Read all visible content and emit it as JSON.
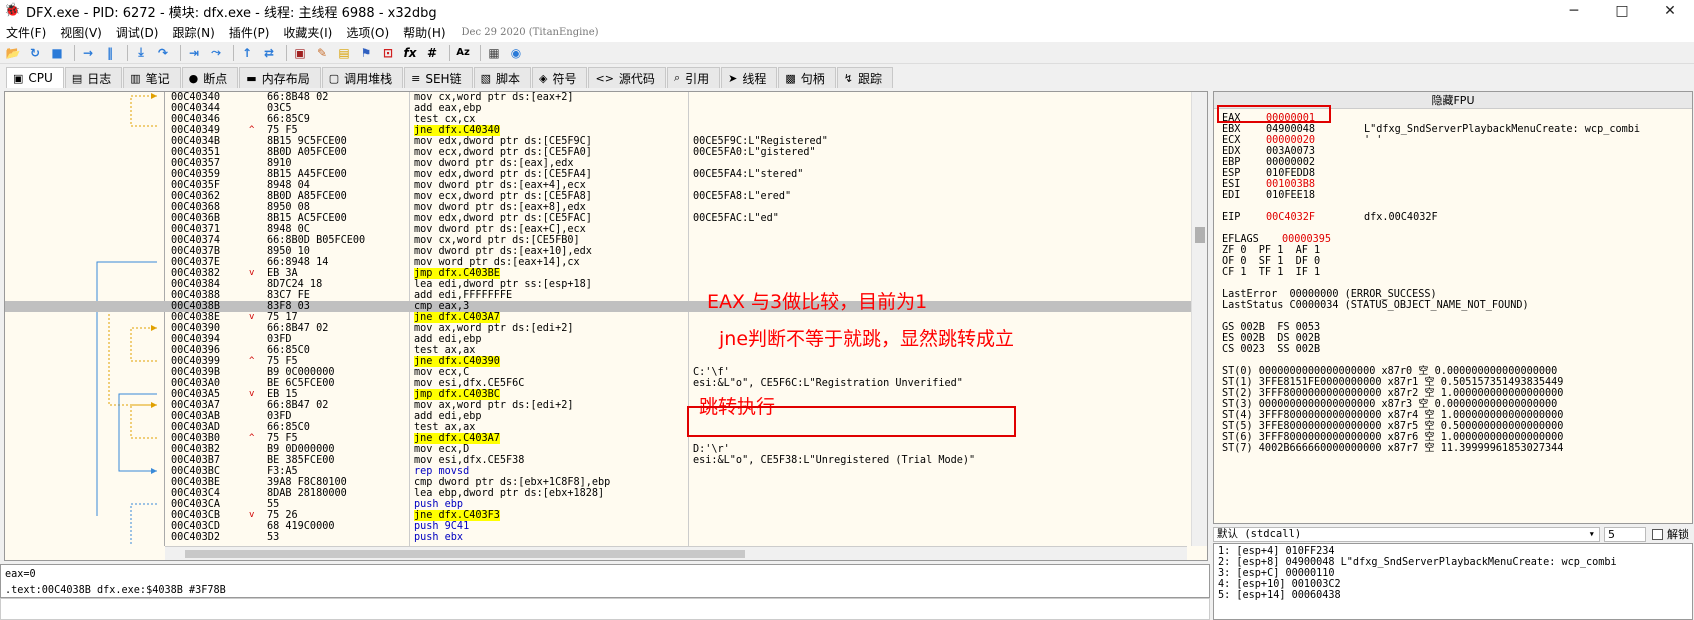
{
  "window": {
    "title": "DFX.exe - PID: 6272 - 模块: dfx.exe - 线程: 主线程 6988 - x32dbg",
    "minimize": "─",
    "maximize": "□",
    "close": "✕"
  },
  "menu": {
    "items": [
      "文件(F)",
      "视图(V)",
      "调试(D)",
      "跟踪(N)",
      "插件(P)",
      "收藏夹(I)",
      "选项(O)",
      "帮助(H)"
    ],
    "build_date": "Dec 29 2020 (TitanEngine)"
  },
  "toolbar": {
    "icons": [
      "open-icon",
      "restart-icon",
      "stop-icon",
      "run-icon",
      "pause-icon",
      "step-into-icon",
      "step-over-icon",
      "trace-into-icon",
      "trace-over-icon",
      "execute-till-return-icon",
      "run-to-user-code-icon",
      "patch-icon",
      "comment-icon",
      "label-icon",
      "bookmark-icon",
      "function-icon",
      "expression-icon",
      "hash-icon",
      "string-format-icon",
      "calculator-icon",
      "system-info-icon"
    ],
    "glyphs": [
      "📂",
      "↻",
      "■",
      "→",
      "‖",
      "⤓",
      "↷",
      "⇥",
      "⤳",
      "↑",
      "⇄",
      "▣",
      "✎",
      "▤",
      "⚑",
      "⊡",
      "fx",
      "#",
      "Az",
      "▦",
      "◉"
    ]
  },
  "tabs": [
    {
      "icon": "cpu-icon",
      "glyph": "▣",
      "label": "CPU",
      "active": true
    },
    {
      "icon": "log-icon",
      "glyph": "▤",
      "label": "日志"
    },
    {
      "icon": "notes-icon",
      "glyph": "▥",
      "label": "笔记"
    },
    {
      "icon": "breakpoint-icon",
      "glyph": "●",
      "label": "断点"
    },
    {
      "icon": "memory-map-icon",
      "glyph": "▬",
      "label": "内存布局"
    },
    {
      "icon": "call-stack-icon",
      "glyph": "▢",
      "label": "调用堆栈"
    },
    {
      "icon": "seh-icon",
      "glyph": "≡",
      "label": "SEH链"
    },
    {
      "icon": "script-icon",
      "glyph": "▧",
      "label": "脚本"
    },
    {
      "icon": "symbols-icon",
      "glyph": "◈",
      "label": "符号"
    },
    {
      "icon": "source-icon",
      "glyph": "<>",
      "label": "源代码"
    },
    {
      "icon": "references-icon",
      "glyph": "⌕",
      "label": "引用"
    },
    {
      "icon": "threads-icon",
      "glyph": "➤",
      "label": "线程"
    },
    {
      "icon": "handles-icon",
      "glyph": "▩",
      "label": "句柄"
    },
    {
      "icon": "trace-icon",
      "glyph": "↯",
      "label": "跟踪"
    }
  ],
  "disasm": {
    "rows": [
      {
        "addr": "00C40340",
        "arrow": "",
        "bytes": "66:8B48 02",
        "instr": "mov cx,word ptr ds:[eax+2]",
        "cmt": ""
      },
      {
        "addr": "00C40344",
        "arrow": "",
        "bytes": "03C5",
        "instr": "add eax,ebp",
        "cmt": ""
      },
      {
        "addr": "00C40346",
        "arrow": "",
        "bytes": "66:85C9",
        "instr": "test cx,cx",
        "cmt": ""
      },
      {
        "addr": "00C40349",
        "arrow": "^",
        "bytes": "75 F5",
        "instr": "jne dfx.C40340",
        "cmt": ""
      },
      {
        "addr": "00C4034B",
        "arrow": "",
        "bytes": "8B15 9C5FCE00",
        "instr": "mov edx,dword ptr ds:[CE5F9C]",
        "cmt": "00CE5F9C:L\"Registered\""
      },
      {
        "addr": "00C40351",
        "arrow": "",
        "bytes": "8B0D A05FCE00",
        "instr": "mov ecx,dword ptr ds:[CE5FA0]",
        "cmt": "00CE5FA0:L\"gistered\""
      },
      {
        "addr": "00C40357",
        "arrow": "",
        "bytes": "8910",
        "instr": "mov dword ptr ds:[eax],edx",
        "cmt": ""
      },
      {
        "addr": "00C40359",
        "arrow": "",
        "bytes": "8B15 A45FCE00",
        "instr": "mov edx,dword ptr ds:[CE5FA4]",
        "cmt": "00CE5FA4:L\"stered\""
      },
      {
        "addr": "00C4035F",
        "arrow": "",
        "bytes": "8948 04",
        "instr": "mov dword ptr ds:[eax+4],ecx",
        "cmt": ""
      },
      {
        "addr": "00C40362",
        "arrow": "",
        "bytes": "8B0D A85FCE00",
        "instr": "mov ecx,dword ptr ds:[CE5FA8]",
        "cmt": "00CE5FA8:L\"ered\""
      },
      {
        "addr": "00C40368",
        "arrow": "",
        "bytes": "8950 08",
        "instr": "mov dword ptr ds:[eax+8],edx",
        "cmt": ""
      },
      {
        "addr": "00C4036B",
        "arrow": "",
        "bytes": "8B15 AC5FCE00",
        "instr": "mov edx,dword ptr ds:[CE5FAC]",
        "cmt": "00CE5FAC:L\"ed\""
      },
      {
        "addr": "00C40371",
        "arrow": "",
        "bytes": "8948 0C",
        "instr": "mov dword ptr ds:[eax+C],ecx",
        "cmt": ""
      },
      {
        "addr": "00C40374",
        "arrow": "",
        "bytes": "66:8B0D B05FCE00",
        "instr": "mov cx,word ptr ds:[CE5FB0]",
        "cmt": ""
      },
      {
        "addr": "00C4037B",
        "arrow": "",
        "bytes": "8950 10",
        "instr": "mov dword ptr ds:[eax+10],edx",
        "cmt": ""
      },
      {
        "addr": "00C4037E",
        "arrow": "",
        "bytes": "66:8948 14",
        "instr": "mov word ptr ds:[eax+14],cx",
        "cmt": ""
      },
      {
        "addr": "00C40382",
        "arrow": "v",
        "bytes": "EB 3A",
        "instr": "jmp dfx.C403BE",
        "cmt": ""
      },
      {
        "addr": "00C40384",
        "arrow": "",
        "bytes": "8D7C24 18",
        "instr": "lea edi,dword ptr ss:[esp+18]",
        "cmt": ""
      },
      {
        "addr": "00C40388",
        "arrow": "",
        "bytes": "83C7 FE",
        "instr": "add edi,FFFFFFFE",
        "cmt": ""
      },
      {
        "addr": "00C4038B",
        "arrow": "",
        "bytes": "83F8 03",
        "instr": "cmp eax,3",
        "cmt": "",
        "sel": true
      },
      {
        "addr": "00C4038E",
        "arrow": "v",
        "bytes": "75 17",
        "instr": "jne dfx.C403A7",
        "cmt": ""
      },
      {
        "addr": "00C40390",
        "arrow": "",
        "bytes": "66:8B47 02",
        "instr": "mov ax,word ptr ds:[edi+2]",
        "cmt": ""
      },
      {
        "addr": "00C40394",
        "arrow": "",
        "bytes": "03FD",
        "instr": "add edi,ebp",
        "cmt": ""
      },
      {
        "addr": "00C40396",
        "arrow": "",
        "bytes": "66:85C0",
        "instr": "test ax,ax",
        "cmt": ""
      },
      {
        "addr": "00C40399",
        "arrow": "^",
        "bytes": "75 F5",
        "instr": "jne dfx.C40390",
        "cmt": ""
      },
      {
        "addr": "00C4039B",
        "arrow": "",
        "bytes": "B9 0C000000",
        "instr": "mov ecx,C",
        "cmt": "C:'\\f'"
      },
      {
        "addr": "00C403A0",
        "arrow": "",
        "bytes": "BE 6C5FCE00",
        "instr": "mov esi,dfx.CE5F6C",
        "cmt": "esi:&L\"o\", CE5F6C:L\"Registration Unverified\""
      },
      {
        "addr": "00C403A5",
        "arrow": "v",
        "bytes": "EB 15",
        "instr": "jmp dfx.C403BC",
        "cmt": ""
      },
      {
        "addr": "00C403A7",
        "arrow": "",
        "bytes": "66:8B47 02",
        "instr": "mov ax,word ptr ds:[edi+2]",
        "cmt": ""
      },
      {
        "addr": "00C403AB",
        "arrow": "",
        "bytes": "03FD",
        "instr": "add edi,ebp",
        "cmt": ""
      },
      {
        "addr": "00C403AD",
        "arrow": "",
        "bytes": "66:85C0",
        "instr": "test ax,ax",
        "cmt": ""
      },
      {
        "addr": "00C403B0",
        "arrow": "^",
        "bytes": "75 F5",
        "instr": "jne dfx.C403A7",
        "cmt": ""
      },
      {
        "addr": "00C403B2",
        "arrow": "",
        "bytes": "B9 0D000000",
        "instr": "mov ecx,D",
        "cmt": "D:'\\r'"
      },
      {
        "addr": "00C403B7",
        "arrow": "",
        "bytes": "BE 385FCE00",
        "instr": "mov esi,dfx.CE5F38",
        "cmt": "esi:&L\"o\", CE5F38:L\"Unregistered (Trial Mode)\""
      },
      {
        "addr": "00C403BC",
        "arrow": "",
        "bytes": "F3:A5",
        "instr": "rep movsd",
        "cmt": ""
      },
      {
        "addr": "00C403BE",
        "arrow": "",
        "bytes": "39A8 F8C80100",
        "instr": "cmp dword ptr ds:[ebx+1C8F8],ebp",
        "cmt": ""
      },
      {
        "addr": "00C403C4",
        "arrow": "",
        "bytes": "8DAB 28180000",
        "instr": "lea ebp,dword ptr ds:[ebx+1828]",
        "cmt": ""
      },
      {
        "addr": "00C403CA",
        "arrow": "",
        "bytes": "55",
        "instr": "push ebp",
        "cmt": ""
      },
      {
        "addr": "00C403CB",
        "arrow": "v",
        "bytes": "75 26",
        "instr": "jne dfx.C403F3",
        "cmt": ""
      },
      {
        "addr": "00C403CD",
        "arrow": "",
        "bytes": "68 419C0000",
        "instr": "push 9C41",
        "cmt": ""
      },
      {
        "addr": "00C403D2",
        "arrow": "",
        "bytes": "53",
        "instr": "push ebx",
        "cmt": ""
      }
    ],
    "annotation1": "EAX 与3做比较，目前为1",
    "annotation2": "jne判断不等于就跳，显然跳转成立",
    "annotation3": "跳转执行"
  },
  "registers": {
    "header": "隐藏FPU",
    "gp": [
      {
        "name": "EAX",
        "val": "00000001",
        "extra": "",
        "changed": true
      },
      {
        "name": "EBX",
        "val": "04900048",
        "extra": "L\"dfxg_SndServerPlaybackMenuCreate: wcp_combi"
      },
      {
        "name": "ECX",
        "val": "00000020",
        "extra": "' '",
        "changed": true
      },
      {
        "name": "EDX",
        "val": "003A0073",
        "extra": ""
      },
      {
        "name": "EBP",
        "val": "00000002",
        "extra": ""
      },
      {
        "name": "ESP",
        "val": "010FEDD8",
        "extra": ""
      },
      {
        "name": "ESI",
        "val": "001003B8",
        "extra": "",
        "changed": true
      },
      {
        "name": "EDI",
        "val": "010FEE18",
        "extra": ""
      }
    ],
    "eip": {
      "name": "EIP",
      "val": "00C4032F",
      "extra": "dfx.00C4032F"
    },
    "eflags": {
      "name": "EFLAGS",
      "val": "00000395"
    },
    "flags1": "ZF 0  PF 1  AF 1",
    "flags2": "OF 0  SF 1  DF 0",
    "flags3": "CF 1  TF 1  IF 1",
    "lasterror": "LastError  00000000 (ERROR_SUCCESS)",
    "laststatus": "LastStatus C0000034 (STATUS_OBJECT_NAME_NOT_FOUND)",
    "seg1": "GS 002B  FS 0053",
    "seg2": "ES 002B  DS 002B",
    "seg3": "CS 0023  SS 002B",
    "fpu": [
      "ST(0) 0000000000000000000 x87r0 空 0.000000000000000000",
      "ST(1) 3FFE8151FE0000000000 x87r1 空 0.505157351493835449",
      "ST(2) 3FFF8000000000000000 x87r2 空 1.000000000000000000",
      "ST(3) 0000000000000000000 x87r3 空 0.000000000000000000",
      "ST(4) 3FFF8000000000000000 x87r4 空 1.000000000000000000",
      "ST(5) 3FFE8000000000000000 x87r5 空 0.500000000000000000",
      "ST(6) 3FFF8000000000000000 x87r6 空 1.000000000000000000",
      "ST(7) 4002B666660000000000 x87r7 空 11.39999961853027344"
    ]
  },
  "callconv": {
    "label": "默认 (stdcall)",
    "count": "5",
    "unlock": "解锁"
  },
  "stack": [
    "1: [esp+4] 010FF234",
    "2: [esp+8] 04900048 L\"dfxg_SndServerPlaybackMenuCreate: wcp_combi",
    "3: [esp+C] 00000110",
    "4: [esp+10] 001003C2",
    "5: [esp+14] 00060438"
  ],
  "info": {
    "line1": "eax=0",
    "line2": ".text:00C4038B dfx.exe:$4038B #3F78B"
  }
}
